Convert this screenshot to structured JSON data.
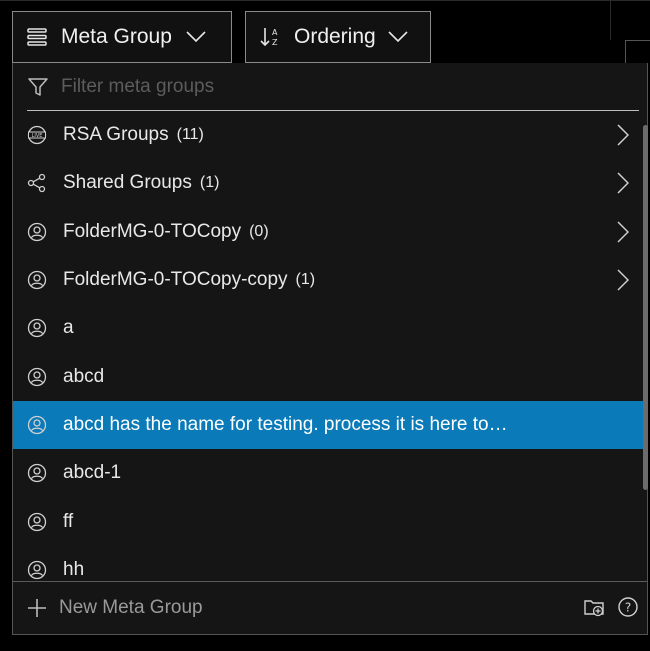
{
  "toolbar": {
    "meta_group_label": "Meta Group",
    "ordering_label": "Ordering"
  },
  "filter": {
    "placeholder": "Filter meta groups"
  },
  "items": [
    {
      "label": "RSA Groups",
      "count": "(11)",
      "icon": "live-icon",
      "has_submenu": true,
      "selected": false
    },
    {
      "label": "Shared Groups",
      "count": "(1)",
      "icon": "share-icon",
      "has_submenu": true,
      "selected": false
    },
    {
      "label": "FolderMG-0-TOCopy",
      "count": "(0)",
      "icon": "user-icon",
      "has_submenu": true,
      "selected": false
    },
    {
      "label": "FolderMG-0-TOCopy-copy",
      "count": "(1)",
      "icon": "user-icon",
      "has_submenu": true,
      "selected": false
    },
    {
      "label": "a",
      "count": "",
      "icon": "user-icon",
      "has_submenu": false,
      "selected": false
    },
    {
      "label": "abcd",
      "count": "",
      "icon": "user-icon",
      "has_submenu": false,
      "selected": false
    },
    {
      "label": "abcd has the name for testing. process it is here to…",
      "count": "",
      "icon": "user-icon",
      "has_submenu": false,
      "selected": true
    },
    {
      "label": "abcd-1",
      "count": "",
      "icon": "user-icon",
      "has_submenu": false,
      "selected": false
    },
    {
      "label": "ff",
      "count": "",
      "icon": "user-icon",
      "has_submenu": false,
      "selected": false
    },
    {
      "label": "hh",
      "count": "",
      "icon": "user-icon",
      "has_submenu": false,
      "selected": false
    }
  ],
  "footer": {
    "new_label": "New Meta Group"
  },
  "colors": {
    "selected": "#0a7ab8",
    "background": "#151515"
  }
}
